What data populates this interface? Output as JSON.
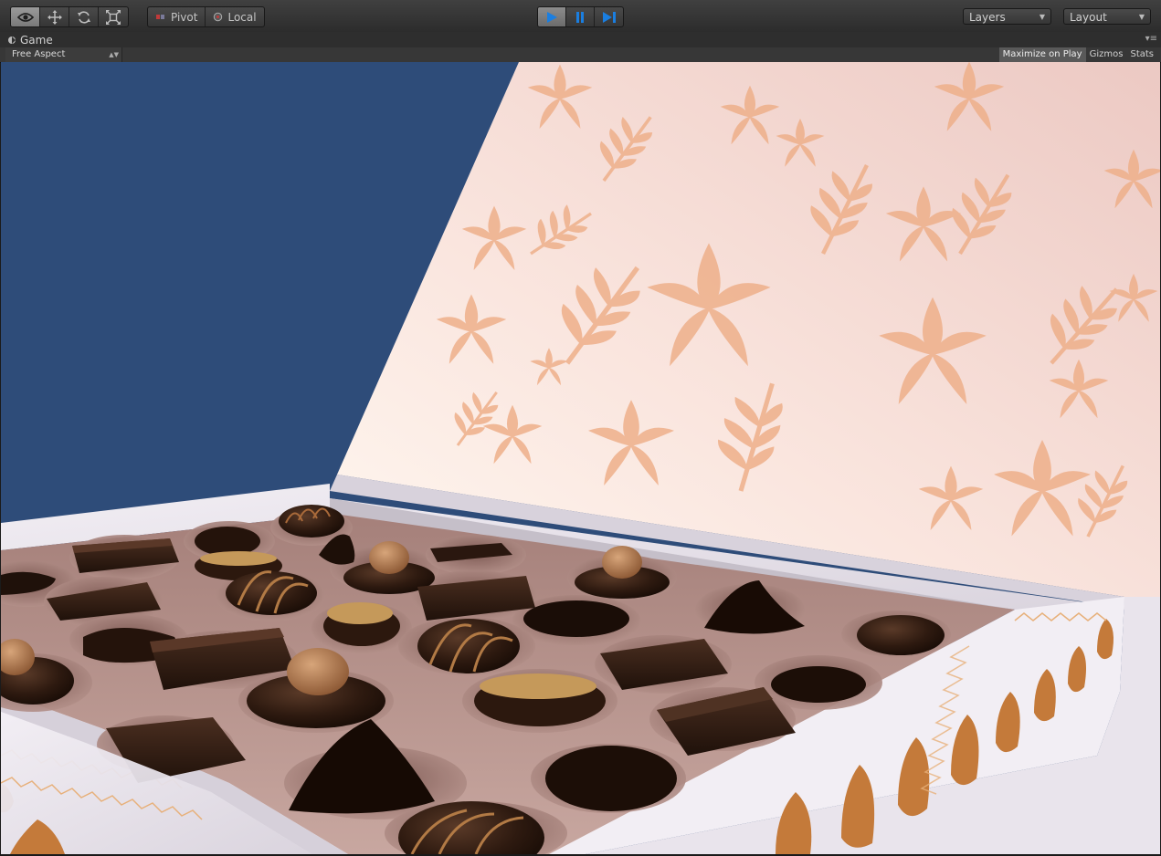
{
  "toolbar": {
    "tools": [
      "view-tool",
      "move-tool",
      "rotate-tool",
      "scale-tool"
    ],
    "pivot_label": "Pivot",
    "local_label": "Local",
    "play_controls": [
      "play-button",
      "pause-button",
      "step-button"
    ],
    "layers_label": "Layers",
    "layout_label": "Layout"
  },
  "game_panel": {
    "tab_label": "Game",
    "aspect_label": "Free Aspect",
    "buttons": [
      {
        "label": "Maximize on Play",
        "active": true
      },
      {
        "label": "Gizmos",
        "active": false
      },
      {
        "label": "Stats",
        "active": false
      }
    ]
  },
  "colors": {
    "background": "#2e4c79",
    "lid_inner": "#f6dcd6",
    "flower": "#eeaf8a",
    "box_white": "#eeeaf0",
    "tray": "#b4918a",
    "chocolate_dark": "#2a170f",
    "chocolate_mid": "#3a2318",
    "accent_play": "#1a7ee0"
  }
}
